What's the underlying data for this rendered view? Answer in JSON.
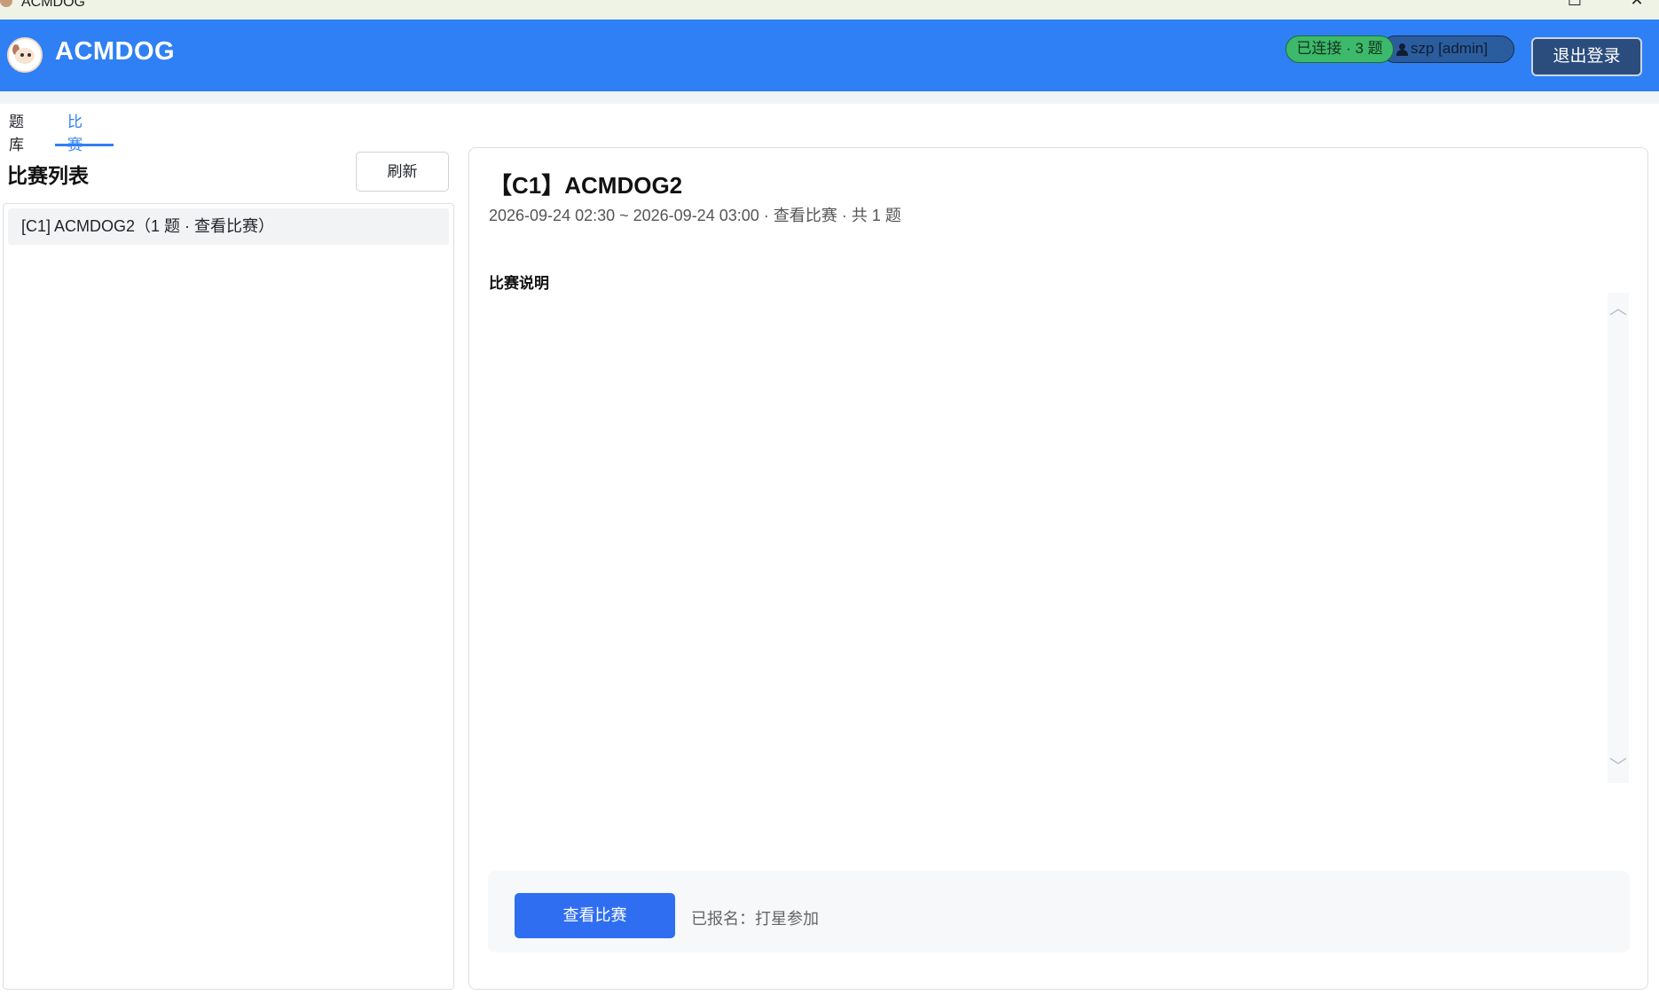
{
  "window": {
    "title": "ACMDOG"
  },
  "header": {
    "brand": "ACMDOG",
    "connection_status": "已连接 · 3 题",
    "user": "szp [admin]",
    "logout_label": "退出登录"
  },
  "tabs": [
    {
      "label": "题库",
      "active": false
    },
    {
      "label": "比赛",
      "active": true
    }
  ],
  "contest_list": {
    "title": "比赛列表",
    "refresh_label": "刷新",
    "items": [
      {
        "label": "[C1] ACMDOG2（1 题 · 查看比赛）"
      }
    ]
  },
  "contest_detail": {
    "title": "【C1】ACMDOG2",
    "meta": "2026-09-24 02:30 ~ 2026-09-24 03:00  ·  查看比赛  ·  共 1 题",
    "description_label": "比赛说明",
    "action_label": "查看比赛",
    "registration_status": "已报名：打星参加"
  },
  "colors": {
    "header_bg": "#2f80f4",
    "accent": "#2f80f4",
    "connected_badge": "#3cb96a",
    "user_badge": "#2b5d9e",
    "logout_btn": "#2b4d7d",
    "primary_btn": "#2f6ef0"
  }
}
